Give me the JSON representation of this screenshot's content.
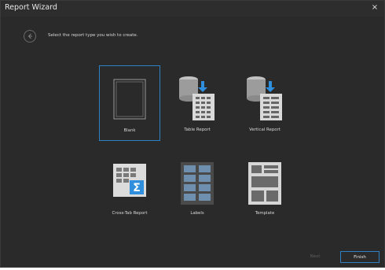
{
  "window": {
    "title": "Report Wizard",
    "close_glyph": "×"
  },
  "header": {
    "instruction": "Select the report type you wish to create."
  },
  "report_types": [
    {
      "label": "Blank",
      "icon": "blank-report-icon",
      "selected": true
    },
    {
      "label": "Table Report",
      "icon": "table-report-icon",
      "selected": false
    },
    {
      "label": "Vertical Report",
      "icon": "vertical-report-icon",
      "selected": false
    },
    {
      "label": "Cross-Tab Report",
      "icon": "cross-tab-report-icon",
      "selected": false
    },
    {
      "label": "Labels",
      "icon": "labels-icon",
      "selected": false
    },
    {
      "label": "Template",
      "icon": "template-icon",
      "selected": false
    }
  ],
  "footer": {
    "next_label": "Next",
    "finish_label": "Finish"
  },
  "colors": {
    "background": "#2a2a2a",
    "accent": "#2f7fc1",
    "text": "#d8d8d8",
    "disabled_text": "#5e5e5e"
  }
}
